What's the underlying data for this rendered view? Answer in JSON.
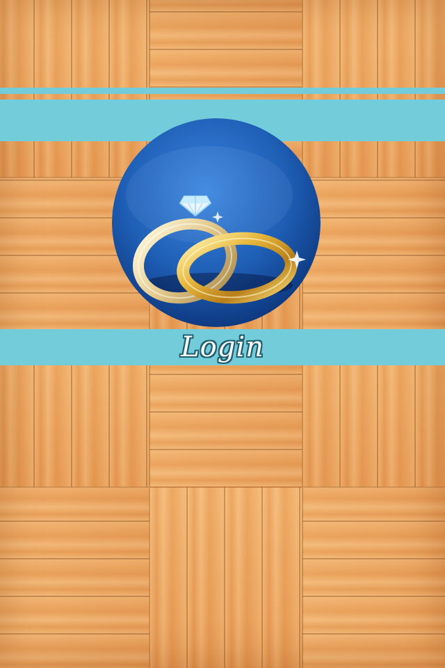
{
  "colors": {
    "band": "#73ccd9",
    "logo_circle": "#1f5fb6",
    "ring_gold": "#e2b23c",
    "login_text": "#ffffff",
    "login_outline": "#1f5f6f"
  },
  "logo": {
    "icon": "wedding-rings-icon"
  },
  "login": {
    "label": "Login"
  }
}
